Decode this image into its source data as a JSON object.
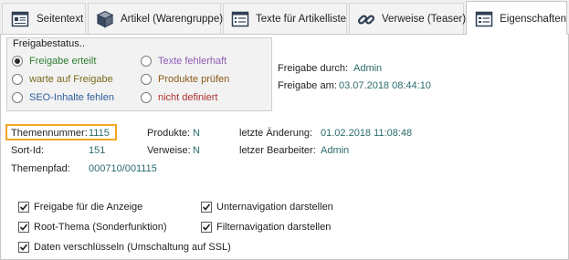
{
  "tabs": [
    {
      "label": "Seitentext",
      "icon": "page-text-icon"
    },
    {
      "label": "Artikel (Warengruppe)",
      "icon": "cube-icon"
    },
    {
      "label": "Texte für Artikelliste",
      "icon": "list-text-icon"
    },
    {
      "label": "Verweise (Teaser)",
      "icon": "link-chain-icon"
    },
    {
      "label": "Eigenschaften",
      "icon": "properties-icon",
      "active": true
    }
  ],
  "freigabe": {
    "title": "Freigabestatus..",
    "options": [
      {
        "label": "Freigabe erteilt",
        "color": "#2e7d32",
        "selected": true
      },
      {
        "label": "warte auf Freigabe",
        "color": "#7a6a1a",
        "selected": false
      },
      {
        "label": "SEO-Inhalte fehlen",
        "color": "#2e5e9e",
        "selected": false
      },
      {
        "label": "Texte fehlerhaft",
        "color": "#8e5bb5",
        "selected": false
      },
      {
        "label": "Produkte prüfen",
        "color": "#8a5a1a",
        "selected": false
      },
      {
        "label": "nicht definiert",
        "color": "#b03030",
        "selected": false
      }
    ]
  },
  "approval": {
    "by_label": "Freigabe durch:",
    "by_value": "Admin",
    "at_label": "Freigabe am:",
    "at_value": "03.07.2018 08:44:10"
  },
  "info": {
    "themennummer_label": "Themennummer:",
    "themennummer_value": "1115",
    "sortid_label": "Sort-Id:",
    "sortid_value": "151",
    "themenpfad_label": "Themenpfad:",
    "themenpfad_value": "000710/001115",
    "produkte_label": "Produkte:",
    "produkte_value": "N",
    "verweise_label": "Verweise:",
    "verweise_value": "N",
    "letzte_aenderung_label": "letzte Änderung:",
    "letzte_aenderung_value": "01.02.2018 11:08:48",
    "letzter_bearbeiter_label": "letzer Bearbeiter:",
    "letzter_bearbeiter_value": "Admin"
  },
  "checkboxes": [
    {
      "label": "Freigabe für die Anzeige",
      "checked": true
    },
    {
      "label": "Root-Thema (Sonderfunktion)",
      "checked": true
    },
    {
      "label": "Daten verschlüsseln (Umschaltung auf SSL)",
      "checked": true
    },
    {
      "label": "Unternavigation darstellen",
      "checked": true
    },
    {
      "label": "Filternavigation darstellen",
      "checked": true
    }
  ],
  "colors": {
    "value_text": "#2b6b6b",
    "highlight": "#f5a623"
  }
}
